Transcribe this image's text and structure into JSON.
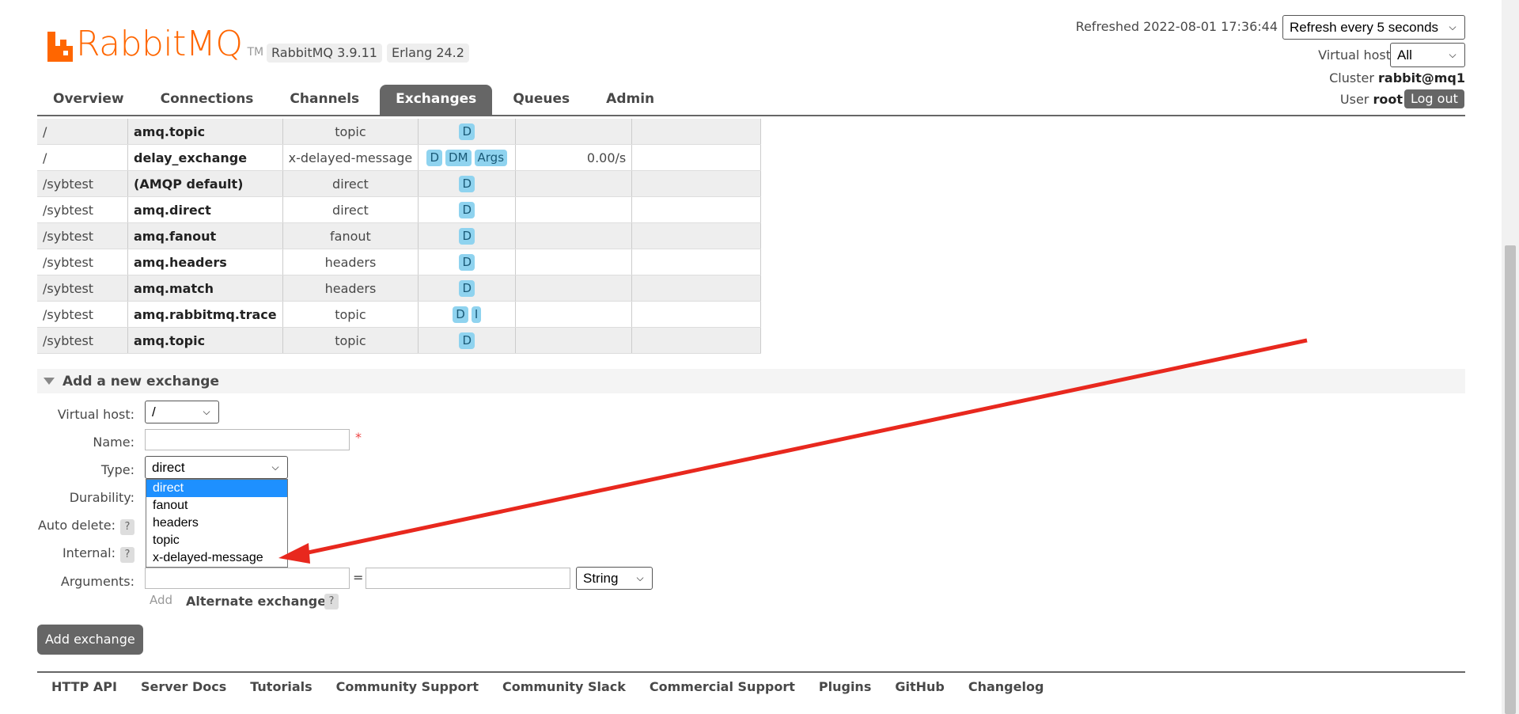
{
  "header": {
    "logo_text": "RabbitMQ",
    "logo_tm": "TM",
    "version": "RabbitMQ 3.9.11",
    "erlang": "Erlang 24.2",
    "refreshed": "Refreshed 2022-08-01 17:36:44",
    "refresh_select": "Refresh every 5 seconds",
    "vhost_label": "Virtual host",
    "vhost_select": "All",
    "cluster_label": "Cluster",
    "cluster_value": "rabbit@mq1",
    "user_label": "User",
    "user_value": "root",
    "logout": "Log out"
  },
  "nav": {
    "tabs": [
      "Overview",
      "Connections",
      "Channels",
      "Exchanges",
      "Queues",
      "Admin"
    ],
    "active": "Exchanges"
  },
  "table": {
    "rows": [
      {
        "vhost": "/",
        "name": "amq.topic",
        "type": "topic",
        "features": [
          "D"
        ],
        "rate_in": "",
        "rate_out": ""
      },
      {
        "vhost": "/",
        "name": "delay_exchange",
        "type": "x-delayed-message",
        "features": [
          "D",
          "DM",
          "Args"
        ],
        "rate_in": "0.00/s",
        "rate_out": ""
      },
      {
        "vhost": "/sybtest",
        "name": "(AMQP default)",
        "type": "direct",
        "features": [
          "D"
        ],
        "rate_in": "",
        "rate_out": ""
      },
      {
        "vhost": "/sybtest",
        "name": "amq.direct",
        "type": "direct",
        "features": [
          "D"
        ],
        "rate_in": "",
        "rate_out": ""
      },
      {
        "vhost": "/sybtest",
        "name": "amq.fanout",
        "type": "fanout",
        "features": [
          "D"
        ],
        "rate_in": "",
        "rate_out": ""
      },
      {
        "vhost": "/sybtest",
        "name": "amq.headers",
        "type": "headers",
        "features": [
          "D"
        ],
        "rate_in": "",
        "rate_out": ""
      },
      {
        "vhost": "/sybtest",
        "name": "amq.match",
        "type": "headers",
        "features": [
          "D"
        ],
        "rate_in": "",
        "rate_out": ""
      },
      {
        "vhost": "/sybtest",
        "name": "amq.rabbitmq.trace",
        "type": "topic",
        "features": [
          "D",
          "I"
        ],
        "rate_in": "",
        "rate_out": ""
      },
      {
        "vhost": "/sybtest",
        "name": "amq.topic",
        "type": "topic",
        "features": [
          "D"
        ],
        "rate_in": "",
        "rate_out": ""
      }
    ]
  },
  "add_exchange": {
    "title": "Add a new exchange",
    "vhost_label": "Virtual host:",
    "vhost_value": "/",
    "name_label": "Name:",
    "name_value": "",
    "required_mark": "*",
    "type_label": "Type:",
    "type_value": "direct",
    "type_options": [
      "direct",
      "fanout",
      "headers",
      "topic",
      "x-delayed-message"
    ],
    "durability_label": "Durability:",
    "auto_delete_label": "Auto delete:",
    "internal_label": "Internal:",
    "help": "?",
    "arguments_label": "Arguments:",
    "equals": "=",
    "arg_type": "String",
    "add_link": "Add",
    "alternate_exchange": "Alternate exchange",
    "submit": "Add exchange"
  },
  "footer": {
    "links": [
      "HTTP API",
      "Server Docs",
      "Tutorials",
      "Community Support",
      "Community Slack",
      "Commercial Support",
      "Plugins",
      "GitHub",
      "Changelog"
    ]
  },
  "colors": {
    "brand": "#ff6600",
    "nav_active": "#666666",
    "badge": "#8fd3ef",
    "annotation_arrow": "#e8281e",
    "selected_option": "#1e90ff"
  }
}
